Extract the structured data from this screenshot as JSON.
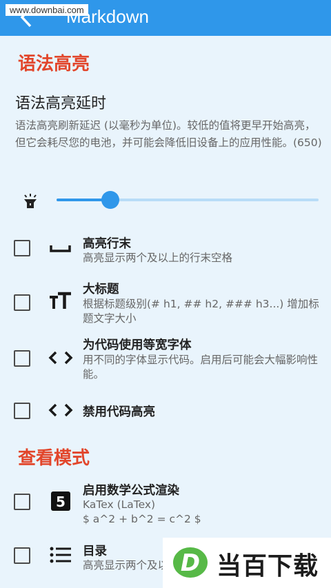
{
  "appbar": {
    "title": "Markdown",
    "watermark": "www.downbai.com"
  },
  "sections": {
    "syntax": "语法高亮",
    "view": "查看模式"
  },
  "delay_pref": {
    "title": "语法高亮延时",
    "desc": "语法高亮刷新延迟 (以毫秒为单位)。较低的值将更早开始高亮，但它会耗尽您的电池，并可能会降低旧设备上的应用性能。(650)",
    "slider_fraction": 0.206
  },
  "rows": [
    {
      "title": "高亮行末",
      "desc": "高亮显示两个及以上的行末空格",
      "icon": "space-bar-icon",
      "checked": false
    },
    {
      "title": "大标题",
      "desc": "根据标题级别(# h1, ## h2, ### h3...) 增加标题文字大小",
      "icon": "text-size-icon",
      "checked": false
    },
    {
      "title": "为代码使用等宽字体",
      "desc": "用不同的字体显示代码。启用后可能会大幅影响性能。",
      "icon": "code-icon",
      "checked": false
    },
    {
      "title": "禁用代码高亮",
      "desc": "",
      "icon": "code-icon",
      "checked": false
    },
    {
      "title": "启用数学公式渲染",
      "desc": "KaTex (LaTex)\n$ a^2 + b^2 = c^2 $",
      "icon": "html5-icon",
      "checked": false
    },
    {
      "title": "目录",
      "desc": "高亮显示两个及以上的行末空格",
      "icon": "list-icon",
      "checked": false
    }
  ],
  "brand": {
    "text": "当百下载",
    "logo_letter": "D"
  },
  "colors": {
    "appbar": "#2f97ea",
    "accent": "#2f97ea",
    "section": "#e2462b",
    "background": "#e9f4fc"
  }
}
